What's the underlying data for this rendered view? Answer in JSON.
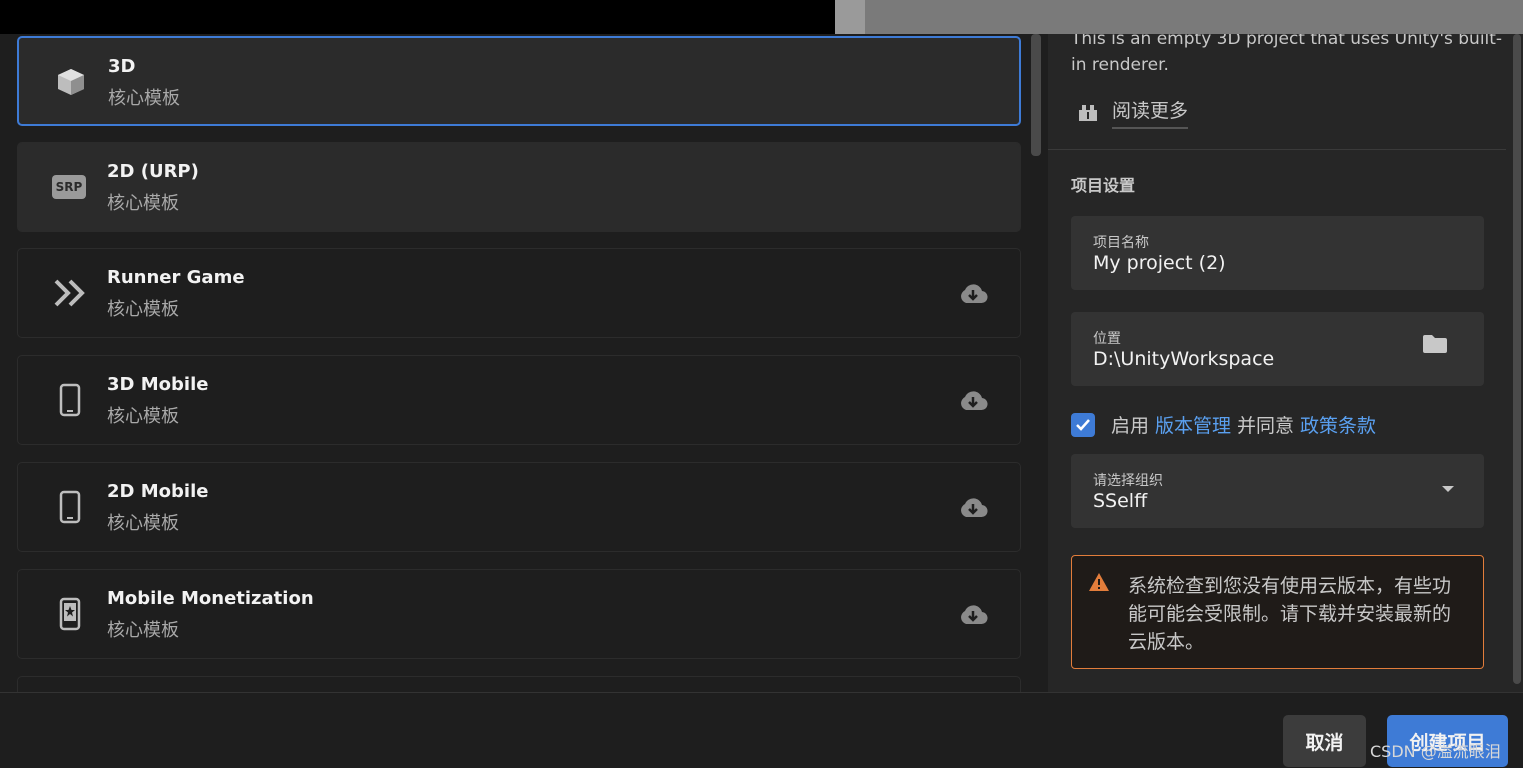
{
  "templates": [
    {
      "name": "3D",
      "subtitle": "核心模板",
      "icon": "cube-icon",
      "state": "selected"
    },
    {
      "name": "2D (URP)",
      "subtitle": "核心模板",
      "icon": "srp-icon",
      "state": "hover"
    },
    {
      "name": "Runner Game",
      "subtitle": "核心模板",
      "icon": "double-chevron-icon",
      "state": "download"
    },
    {
      "name": "3D Mobile",
      "subtitle": "核心模板",
      "icon": "phone-icon",
      "state": "download"
    },
    {
      "name": "2D Mobile",
      "subtitle": "核心模板",
      "icon": "phone-icon",
      "state": "download"
    },
    {
      "name": "Mobile Monetization",
      "subtitle": "核心模板",
      "icon": "phone-star-icon",
      "state": "download"
    }
  ],
  "srp_badge": "SRP",
  "details": {
    "description": "This is an empty 3D project that uses Unity's built-in renderer.",
    "read_more": "阅读更多"
  },
  "settings": {
    "section_title": "项目设置",
    "project_name_label": "项目名称",
    "project_name_value": "My project (2)",
    "location_label": "位置",
    "location_value": "D:\\UnityWorkspace",
    "vc_prefix": "启用",
    "vc_link": "版本管理",
    "vc_middle": "并同意",
    "vc_policy": "政策条款",
    "vc_checked": true,
    "org_label": "请选择组织",
    "org_value": "SSelff",
    "warning": "系统检查到您没有使用云版本，有些功能可能会受限制。请下载并安装最新的云版本。"
  },
  "footer": {
    "cancel": "取消",
    "create": "创建项目"
  },
  "watermark": "CSDN @溢流眼泪",
  "colors": {
    "accent": "#3e7bd6",
    "link": "#5aa0f0",
    "warning": "#e27d3b"
  }
}
